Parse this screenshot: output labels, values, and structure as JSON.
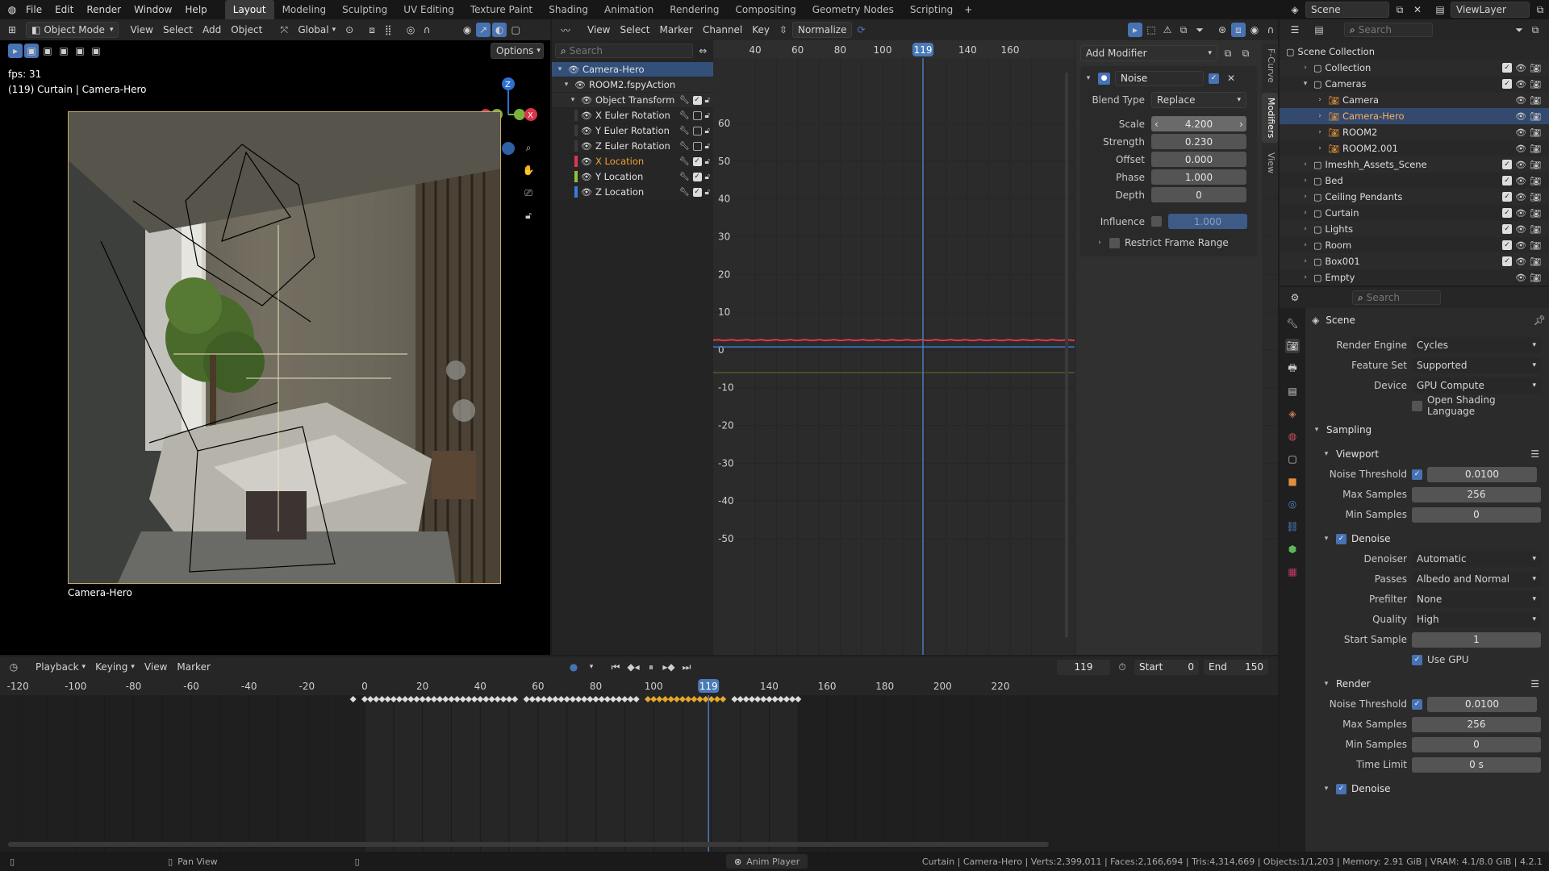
{
  "menu": [
    "File",
    "Edit",
    "Render",
    "Window",
    "Help"
  ],
  "workspaces": [
    "Layout",
    "Modeling",
    "Sculpting",
    "UV Editing",
    "Texture Paint",
    "Shading",
    "Animation",
    "Rendering",
    "Compositing",
    "Geometry Nodes",
    "Scripting"
  ],
  "active_workspace": "Layout",
  "scene_name": "Scene",
  "view_layer": "ViewLayer",
  "viewport": {
    "mode": "Object Mode",
    "menus": [
      "View",
      "Select",
      "Add",
      "Object"
    ],
    "transform": "Global",
    "options": "Options",
    "fps": "fps: 31",
    "info": "(119) Curtain | Camera-Hero",
    "camera_label": "Camera-Hero"
  },
  "graph": {
    "menus": [
      "View",
      "Select",
      "Marker",
      "Channel",
      "Key"
    ],
    "normalize": "Normalize",
    "search_placeholder": "Search",
    "frame_ticks": [
      "40",
      "60",
      "80",
      "100",
      "119",
      "140",
      "160"
    ],
    "current_frame": "119",
    "y_ticks": [
      "60",
      "50",
      "40",
      "30",
      "20",
      "10",
      "0",
      "-10",
      "-20",
      "-30",
      "-40",
      "-50"
    ]
  },
  "channels": [
    {
      "name": "Camera-Hero",
      "level": 0,
      "selected": true,
      "color": "#4a7ab8"
    },
    {
      "name": "ROOM2.fspyAction",
      "level": 1
    },
    {
      "name": "Object Transform",
      "level": 2
    },
    {
      "name": "X Euler Rotation",
      "level": 3,
      "color": "#3a3a3a"
    },
    {
      "name": "Y Euler Rotation",
      "level": 3,
      "color": "#3a3a3a"
    },
    {
      "name": "Z Euler Rotation",
      "level": 3,
      "color": "#3a3a3a"
    },
    {
      "name": "X Location",
      "level": 3,
      "color": "#e0364f",
      "active": true
    },
    {
      "name": "Y Location",
      "level": 3,
      "color": "#8dc23a"
    },
    {
      "name": "Z Location",
      "level": 3,
      "color": "#3b7ad8"
    }
  ],
  "modifier": {
    "add": "Add Modifier",
    "name": "Noise",
    "blend_type_label": "Blend Type",
    "blend_type": "Replace",
    "fields": [
      {
        "label": "Scale",
        "value": "4.200"
      },
      {
        "label": "Strength",
        "value": "0.230"
      },
      {
        "label": "Offset",
        "value": "0.000"
      },
      {
        "label": "Phase",
        "value": "1.000"
      },
      {
        "label": "Depth",
        "value": "0"
      }
    ],
    "influence_label": "Influence",
    "influence": "1.000",
    "restrict": "Restrict Frame Range"
  },
  "side_tabs": [
    "F-Curve",
    "Modifiers",
    "View"
  ],
  "outliner": {
    "search_placeholder": "Search",
    "items": [
      {
        "name": "Scene Collection",
        "level": 0
      },
      {
        "name": "Collection",
        "level": 1
      },
      {
        "name": "Cameras",
        "level": 1,
        "open": true
      },
      {
        "name": "Camera",
        "level": 2
      },
      {
        "name": "Camera-Hero",
        "level": 2,
        "selected": true
      },
      {
        "name": "ROOM2",
        "level": 2
      },
      {
        "name": "ROOM2.001",
        "level": 2
      },
      {
        "name": "Imeshh_Assets_Scene",
        "level": 1
      },
      {
        "name": "Bed",
        "level": 1
      },
      {
        "name": "Ceiling Pendants",
        "level": 1
      },
      {
        "name": "Curtain",
        "level": 1
      },
      {
        "name": "Lights",
        "level": 1
      },
      {
        "name": "Room",
        "level": 1
      },
      {
        "name": "Box001",
        "level": 1
      },
      {
        "name": "Empty",
        "level": 1
      }
    ]
  },
  "properties": {
    "search_placeholder": "Search",
    "title": "Scene",
    "engine_label": "Render Engine",
    "engine": "Cycles",
    "feature_label": "Feature Set",
    "feature": "Supported",
    "device_label": "Device",
    "device": "GPU Compute",
    "osl": "Open Shading Language",
    "sampling": "Sampling",
    "viewport": "Viewport",
    "vp_noise_label": "Noise Threshold",
    "vp_noise": "0.0100",
    "vp_max_label": "Max Samples",
    "vp_max": "256",
    "vp_min_label": "Min Samples",
    "vp_min": "0",
    "denoise": "Denoise",
    "denoiser_label": "Denoiser",
    "denoiser": "Automatic",
    "passes_label": "Passes",
    "passes": "Albedo and Normal",
    "prefilter_label": "Prefilter",
    "prefilter": "None",
    "quality_label": "Quality",
    "quality": "High",
    "start_label": "Start Sample",
    "start": "1",
    "use_gpu": "Use GPU",
    "render": "Render",
    "r_noise_label": "Noise Threshold",
    "r_noise": "0.0100",
    "r_max_label": "Max Samples",
    "r_max": "256",
    "r_min_label": "Min Samples",
    "r_min": "0",
    "time_label": "Time Limit",
    "time": "0 s",
    "denoise2": "Denoise"
  },
  "timeline": {
    "menus": [
      "Playback",
      "Keying",
      "View",
      "Marker"
    ],
    "frame": "119",
    "start_label": "Start",
    "start": "0",
    "end_label": "End",
    "end": "150",
    "ticks": [
      "-120",
      "-100",
      "-80",
      "-60",
      "-40",
      "-20",
      "0",
      "20",
      "40",
      "60",
      "80",
      "100",
      "119",
      "140",
      "160",
      "180",
      "200",
      "220"
    ]
  },
  "status": {
    "left": "Pan View",
    "center": "Anim Player",
    "right": "Curtain | Camera-Hero | Verts:2,399,011 | Faces:2,166,694 | Tris:4,314,669 | Objects:1/1,203 | Memory: 2.91 GiB | VRAM: 4.1/8.0 GiB | 4.2.1"
  },
  "colors": {
    "accent": "#4772b3",
    "frame_blue": "#4a7ab8",
    "curve_red": "#e0364f",
    "curve_blue": "#3b7ad8",
    "key_orange": "#e6a82a"
  }
}
